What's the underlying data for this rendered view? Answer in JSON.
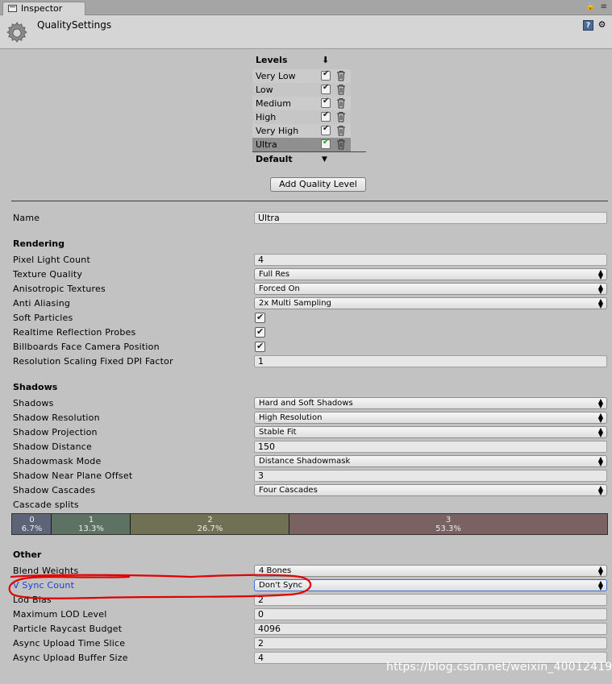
{
  "window": {
    "tab_label": "Inspector",
    "title": "QualitySettings"
  },
  "levels": {
    "header": "Levels",
    "items": [
      {
        "label": "Very Low"
      },
      {
        "label": "Low"
      },
      {
        "label": "Medium"
      },
      {
        "label": "High"
      },
      {
        "label": "Very High"
      },
      {
        "label": "Ultra",
        "selected": true
      }
    ],
    "default_label": "Default",
    "add_button": "Add Quality Level"
  },
  "name": {
    "label": "Name",
    "value": "Ultra"
  },
  "rendering": {
    "header": "Rendering",
    "pixel_light_count": {
      "label": "Pixel Light Count",
      "value": "4"
    },
    "texture_quality": {
      "label": "Texture Quality",
      "value": "Full Res"
    },
    "anisotropic_textures": {
      "label": "Anisotropic Textures",
      "value": "Forced On"
    },
    "anti_aliasing": {
      "label": "Anti Aliasing",
      "value": "2x Multi Sampling"
    },
    "soft_particles": {
      "label": "Soft Particles",
      "checked": true
    },
    "realtime_reflection_probes": {
      "label": "Realtime Reflection Probes",
      "checked": true
    },
    "billboards_face_camera": {
      "label": "Billboards Face Camera Position",
      "checked": true
    },
    "resolution_scaling": {
      "label": "Resolution Scaling Fixed DPI Factor",
      "value": "1"
    }
  },
  "shadows": {
    "header": "Shadows",
    "shadows": {
      "label": "Shadows",
      "value": "Hard and Soft Shadows"
    },
    "shadow_resolution": {
      "label": "Shadow Resolution",
      "value": "High Resolution"
    },
    "shadow_projection": {
      "label": "Shadow Projection",
      "value": "Stable Fit"
    },
    "shadow_distance": {
      "label": "Shadow Distance",
      "value": "150"
    },
    "shadowmask_mode": {
      "label": "Shadowmask Mode",
      "value": "Distance Shadowmask"
    },
    "shadow_near_plane_offset": {
      "label": "Shadow Near Plane Offset",
      "value": "3"
    },
    "shadow_cascades": {
      "label": "Shadow Cascades",
      "value": "Four Cascades"
    },
    "cascade_splits": {
      "label": "Cascade splits",
      "segments": [
        {
          "index": "0",
          "percent": "6.7%",
          "fraction": 0.067,
          "color": "#5e6478"
        },
        {
          "index": "1",
          "percent": "13.3%",
          "fraction": 0.133,
          "color": "#5e7263"
        },
        {
          "index": "2",
          "percent": "26.7%",
          "fraction": 0.267,
          "color": "#707055"
        },
        {
          "index": "3",
          "percent": "53.3%",
          "fraction": 0.533,
          "color": "#7a6262"
        }
      ]
    }
  },
  "other": {
    "header": "Other",
    "blend_weights": {
      "label": "Blend Weights",
      "value": "4 Bones"
    },
    "v_sync_count": {
      "label": "V Sync Count",
      "value": "Don't Sync"
    },
    "lod_bias": {
      "label": "Lod Bias",
      "value": "2"
    },
    "maximum_lod_level": {
      "label": "Maximum LOD Level",
      "value": "0"
    },
    "particle_raycast_budget": {
      "label": "Particle Raycast Budget",
      "value": "4096"
    },
    "async_upload_time_slice": {
      "label": "Async Upload Time Slice",
      "value": "2"
    },
    "async_upload_buffer_size": {
      "label": "Async Upload Buffer Size",
      "value": "4"
    }
  },
  "colors": {
    "annotation": "#e00000",
    "focus": "#3b6fd6",
    "highlight_text": "#1a3fd6"
  },
  "watermark": "https://blog.csdn.net/weixin_40012419"
}
